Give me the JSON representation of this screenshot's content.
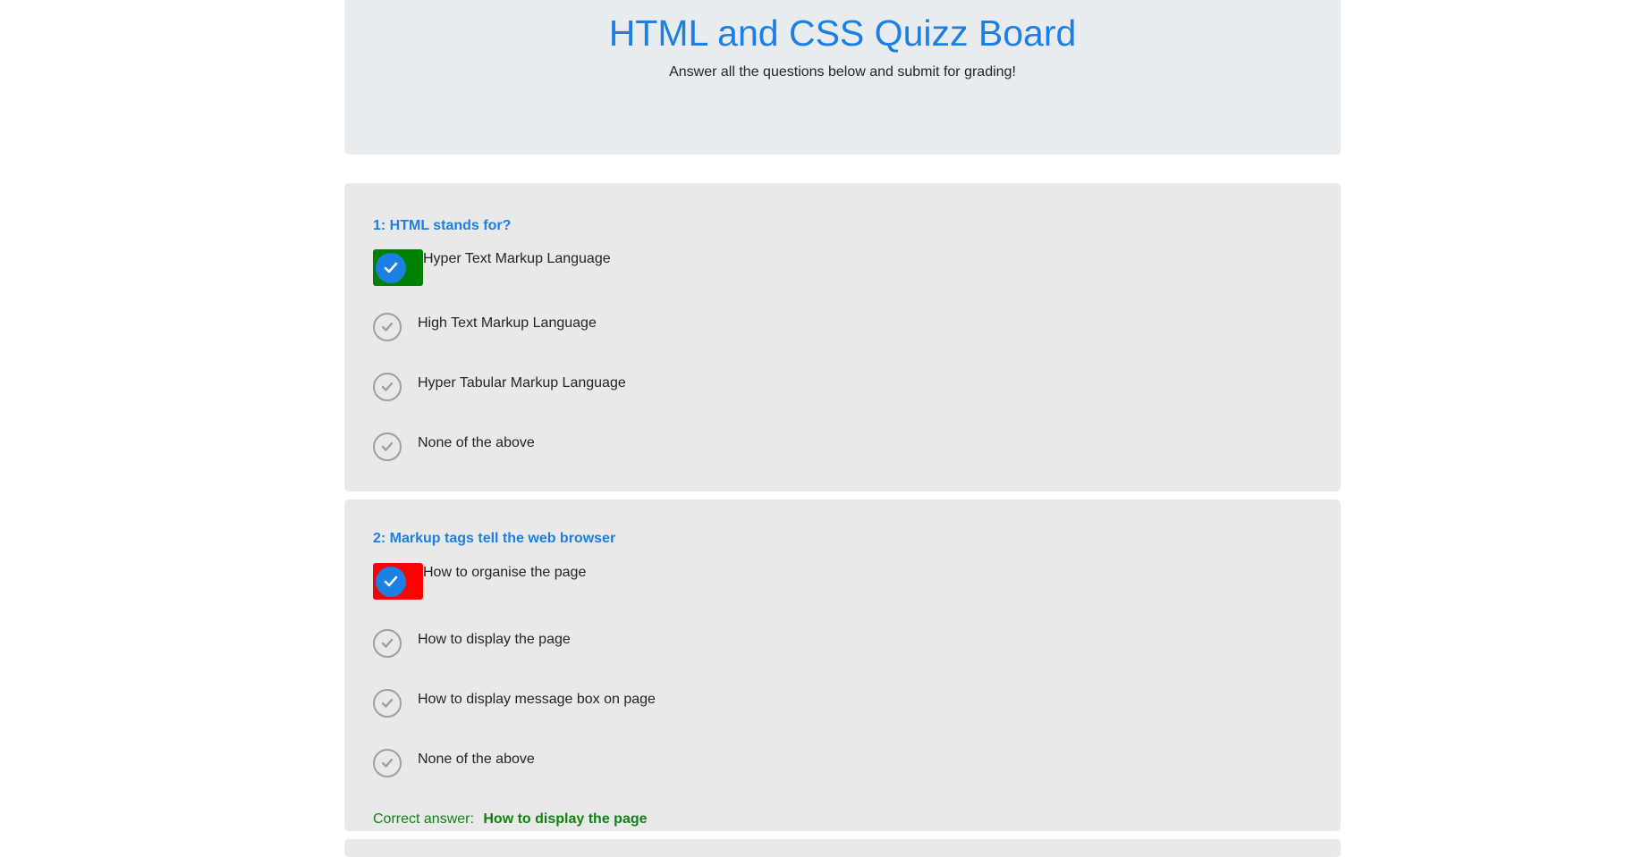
{
  "header": {
    "title": "HTML and CSS Quizz Board",
    "subtitle": "Answer all the questions below and submit for grading!"
  },
  "colors": {
    "accent": "#1b7fe3",
    "correct_bg": "#008000",
    "wrong_bg": "#ff0000",
    "correct_text": "#128012",
    "card_bg": "#e9e9e9"
  },
  "questions": [
    {
      "title": "1: HTML stands for?",
      "options": [
        {
          "label": "Hyper Text Markup Language",
          "state": "selected-correct"
        },
        {
          "label": "High Text Markup Language",
          "state": "unselected"
        },
        {
          "label": "Hyper Tabular Markup Language",
          "state": "unselected"
        },
        {
          "label": "None of the above",
          "state": "unselected"
        }
      ]
    },
    {
      "title": "2: Markup tags tell the web browser",
      "options": [
        {
          "label": "How to organise the page",
          "state": "selected-wrong"
        },
        {
          "label": "How to display the page",
          "state": "unselected"
        },
        {
          "label": "How to display message box on page",
          "state": "unselected"
        },
        {
          "label": "None of the above",
          "state": "unselected"
        }
      ],
      "correct_prefix": "Correct answer:",
      "correct_answer": "How to display the page"
    }
  ],
  "icons": {
    "option_check": "check-icon"
  }
}
